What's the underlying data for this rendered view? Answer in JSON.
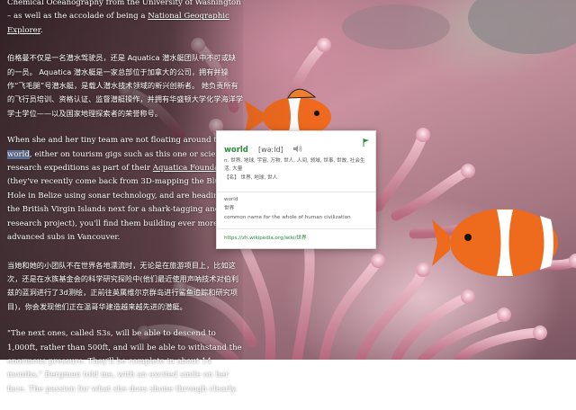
{
  "article": {
    "p1": {
      "text": "Chemical Oceanography from the University of Washington – as well as the accolade of being a ",
      "link": "National Geographic Explorer",
      "end": "."
    },
    "p2": "伯格曼不仅是一名潜水驾驶员，还是 Aquatica 潜水艇团队中不可或缺的一员。 Aquatica 潜水艇是一家总部位于加拿大的公司，拥有并操作“飞毛腿”号潜水艇，是载人潜水技术领域的新兴创新者。 她负责所有的飞行员培训、资格认证、监督潜艇操作，并拥有华盛顿大学化学海洋学学士学位——以及国家地理探索者的荣誉称号。",
    "p3": {
      "before": "When she and her tiny team are not floating around the ",
      "highlight": "world",
      "after": ", either on tourism gigs such as this one or scientific research expeditions as part of their ",
      "link": "Aquatica Foundation",
      "rest": " (they've recently come back from 3D-mapping the Blue Hole in Belize using sonar technology, and are heading to the British Virgin Islands next for a shark-tagging and research project), you'll find them building ever more advanced subs in Vancouver."
    },
    "p4": "当她和她的小团队不在世界各地漂流时，无论是在旅游项目上，比如这次，还是在水族基金会的科学研究探险中(他们最近使用声呐技术对伯利兹的蓝洞进行了3d测绘，正前往英属维尔京群岛进行鲨鱼追踪和研究项目)，你会发现他们正在温哥华建造越来越先进的潜艇。",
    "p5": "\"The next ones, called S3s, will be able to descend to 1,000ft, rather than 500ft, and will be able to withstand the enormous pressure. They'll be complete in about 14 months,\" Bergman told me, with an excited smile on her face. The passion for what she does shone through clearly."
  },
  "popup": {
    "word": "world",
    "phonetic": "[wəːld]",
    "speaker_icon": "speaker-icon",
    "flag_icon": "flag-icon",
    "def_noun": "n. 世界, 地球, 宇宙, 万物, 世人, 人间, 领域, 世事, 世故, 社会生活, 大量",
    "def_adj": "【名】 世界, 地球, 世人",
    "en_word": "world",
    "en_zh": "世界",
    "en_def": "common name for the whole of human civilization",
    "wiki_link": "https://zh.wikipedia.org/wiki/世界"
  },
  "colors": {
    "accent_green": "#2a8a3a",
    "highlight": "#78aae6"
  }
}
